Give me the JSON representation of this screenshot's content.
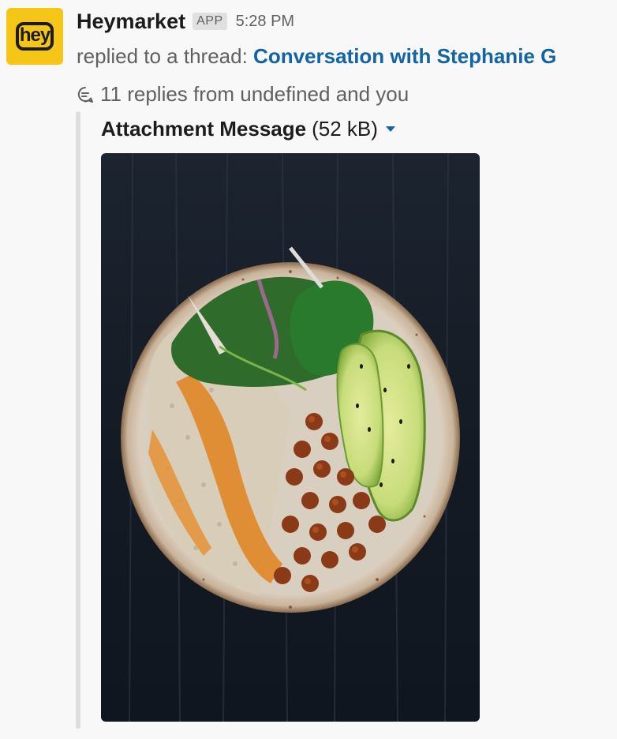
{
  "message": {
    "sender": "Heymarket",
    "app_badge": "APP",
    "time": "5:28 PM",
    "avatar_text": "hey",
    "thread_prefix": "replied to a thread:",
    "thread_link": "Conversation with Stephanie G",
    "replies_text": "11 replies from undefined and you"
  },
  "attachment": {
    "name": "Attachment Message",
    "size": "(52 kB)"
  },
  "colors": {
    "link": "#1264a3",
    "avatar": "#f5c518"
  }
}
